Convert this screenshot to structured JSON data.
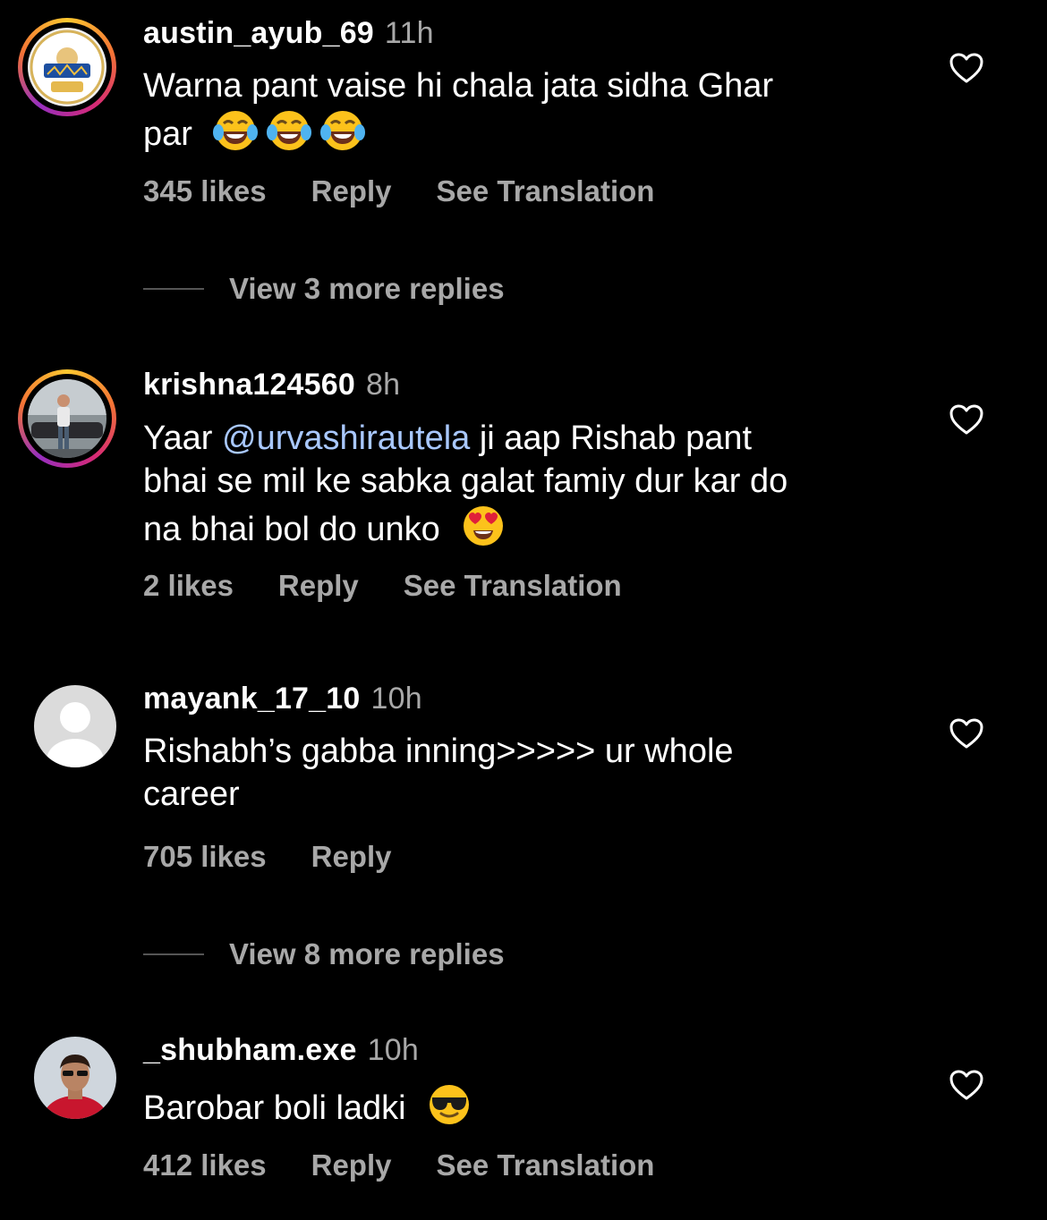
{
  "comments": [
    {
      "username": "austin_ayub_69",
      "time": "11h",
      "text_line1": "Warna pant vaise hi chala jata sidha Ghar",
      "text_line2": "par",
      "likes": "345 likes",
      "reply": "Reply",
      "translation": "See Translation",
      "avatar": "mumbai-indians-logo",
      "emoji": "tears-of-joy"
    },
    {
      "username": "krishna124560",
      "time": "8h",
      "text_before": "Yaar ",
      "mention": "@urvashirautela",
      "text_after": " ji aap Rishab pant",
      "text_line2": "bhai se mil ke sabka galat famiy dur kar do",
      "text_line3": "na bhai bol do unko",
      "likes": "2 likes",
      "reply": "Reply",
      "translation": "See Translation",
      "avatar": "user-photo",
      "emoji": "heart-eyes"
    },
    {
      "username": "mayank_17_10",
      "time": "10h",
      "text_line1": "Rishabh’s gabba inning>>>>> ur whole",
      "text_line2": "career",
      "likes": "705 likes",
      "reply": "Reply",
      "avatar": "default-avatar"
    },
    {
      "username": "_shubham.exe",
      "time": "10h",
      "text_line1": "Barobar boli ladki",
      "likes": "412 likes",
      "reply": "Reply",
      "translation": "See Translation",
      "avatar": "user-photo",
      "emoji": "sunglasses"
    }
  ],
  "view_more_1": "View 3 more replies",
  "view_more_2": "View 8 more replies",
  "colors": {
    "background": "#000000",
    "text": "#ffffff",
    "secondary": "#a8a8a8",
    "mention": "#a9c8ff"
  },
  "icons": {
    "like": "heart-outline-icon"
  }
}
